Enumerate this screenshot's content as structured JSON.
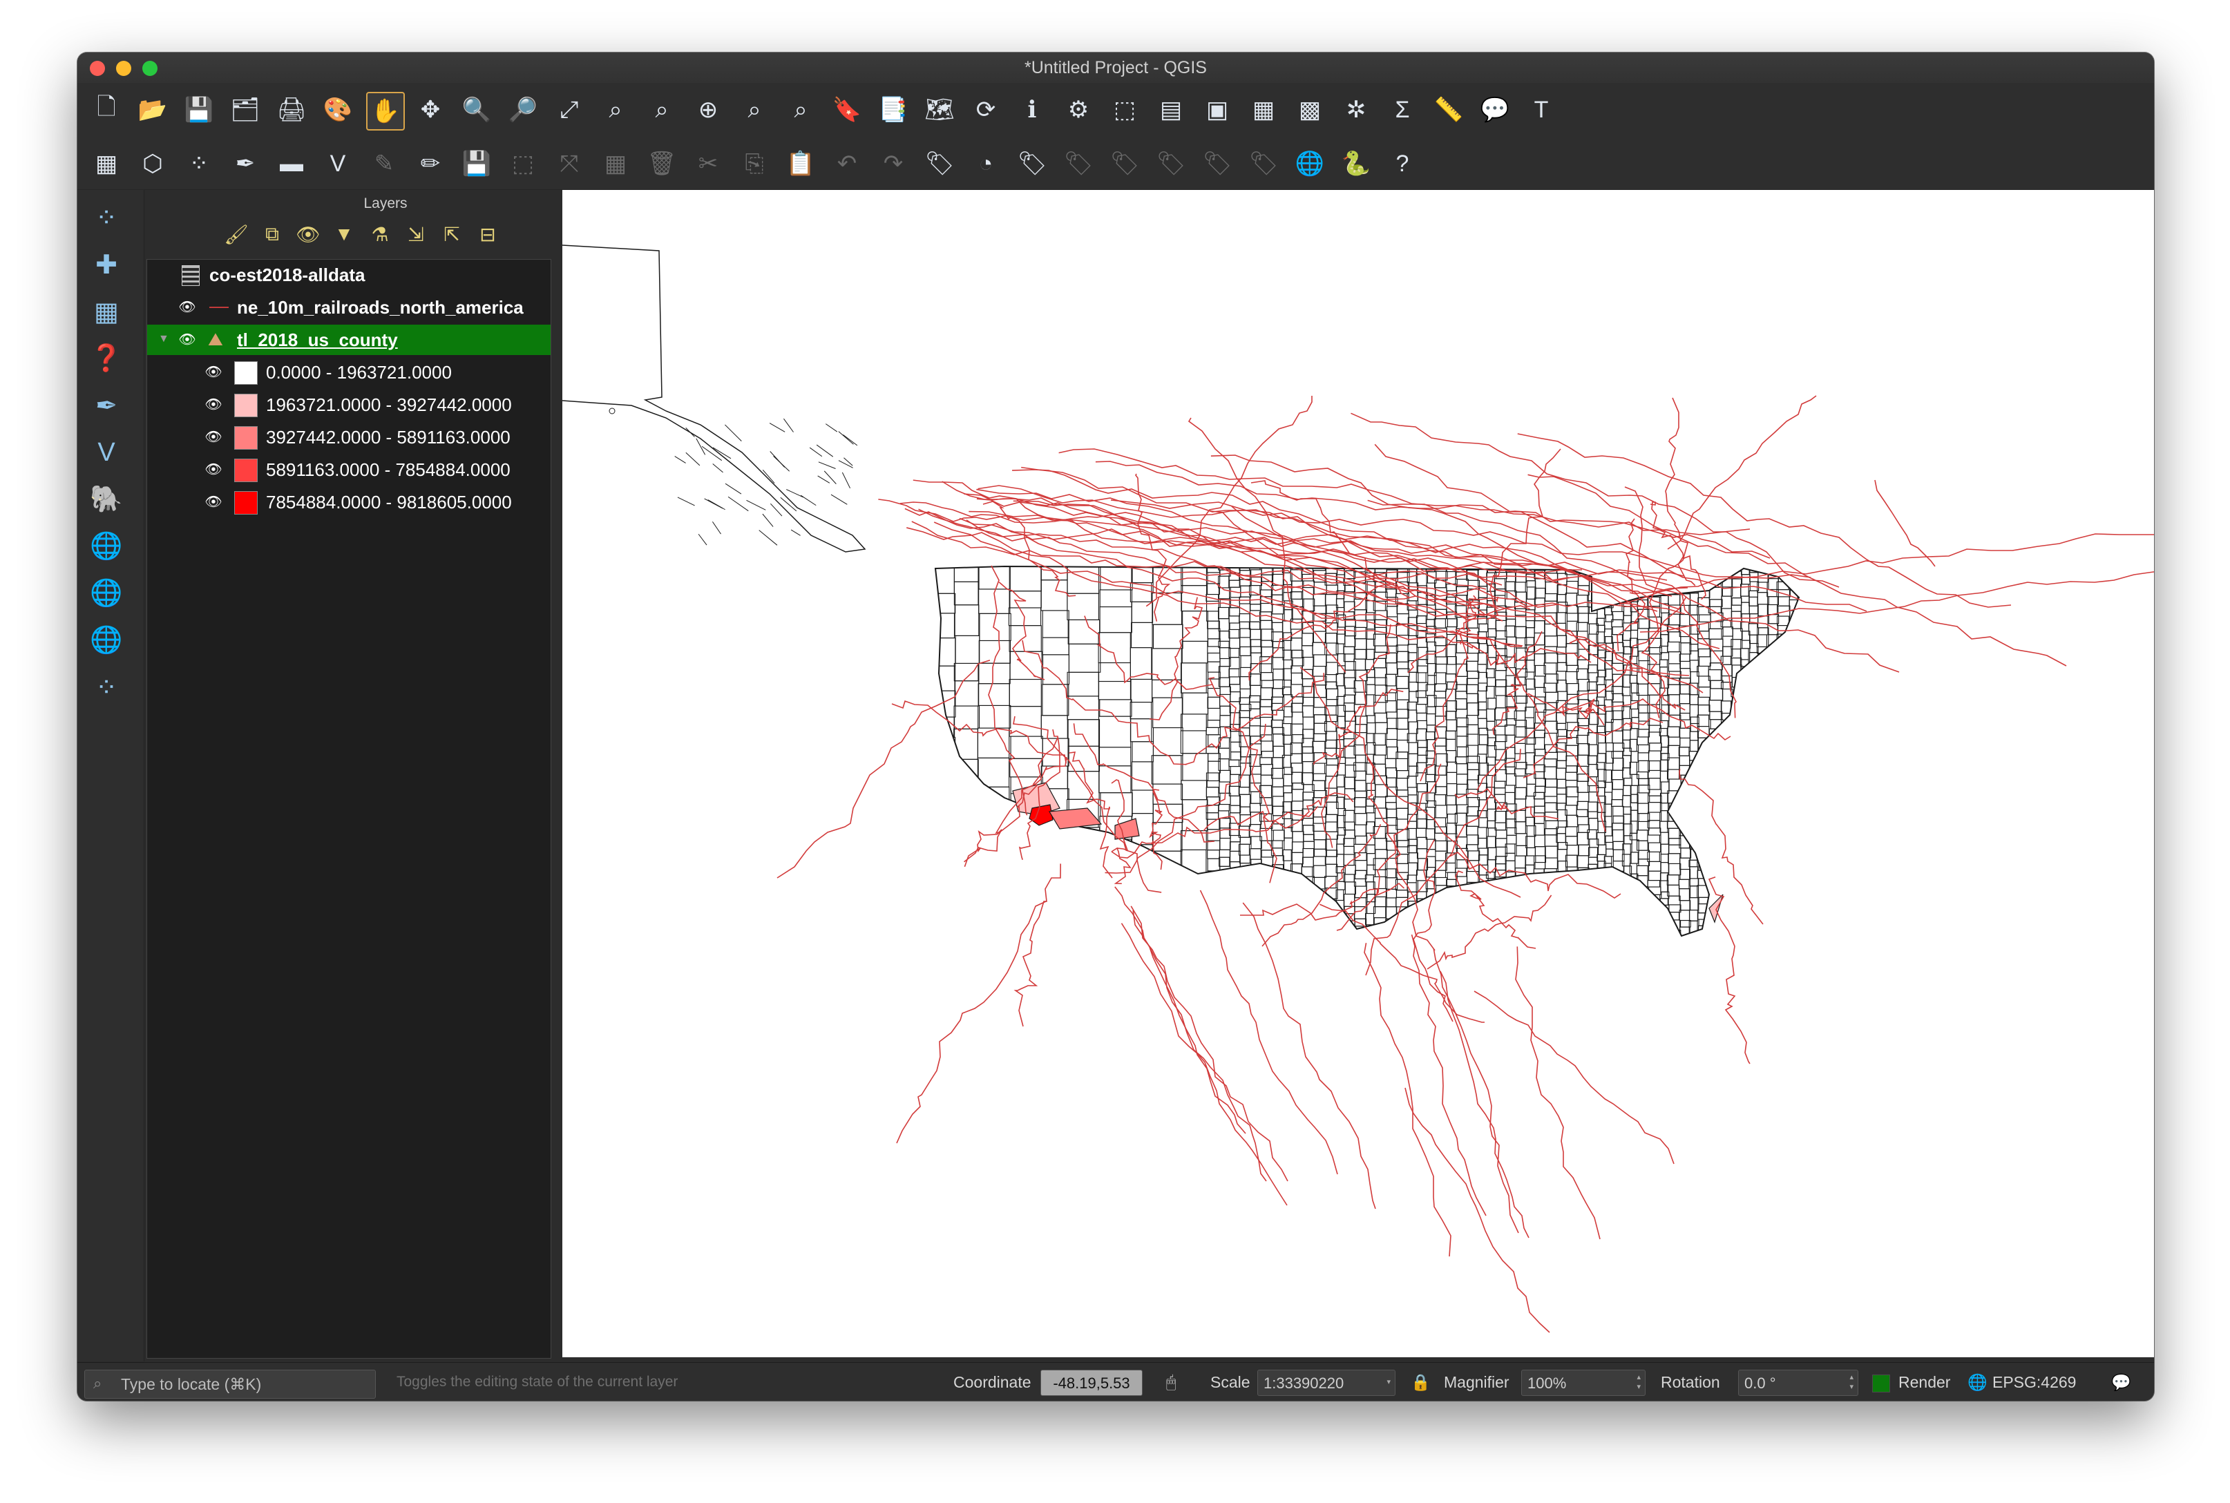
{
  "window": {
    "title": "*Untitled Project - QGIS"
  },
  "toolbar_row1": [
    {
      "name": "new-project-icon",
      "glyph": "🗋"
    },
    {
      "name": "open-project-icon",
      "glyph": "📂"
    },
    {
      "name": "save-project-icon",
      "glyph": "💾"
    },
    {
      "name": "save-as-icon",
      "glyph": "🗂"
    },
    {
      "name": "print-layout-icon",
      "glyph": "🖨"
    },
    {
      "name": "style-manager-icon",
      "glyph": "🎨"
    },
    {
      "name": "pan-icon",
      "glyph": "✋"
    },
    {
      "name": "pan-to-selection-icon",
      "glyph": "✥"
    },
    {
      "name": "zoom-in-icon",
      "glyph": "🔍"
    },
    {
      "name": "zoom-out-icon",
      "glyph": "🔎"
    },
    {
      "name": "zoom-full-icon",
      "glyph": "⤢"
    },
    {
      "name": "zoom-to-selection-icon",
      "glyph": "⌕"
    },
    {
      "name": "zoom-to-layer-icon",
      "glyph": "⌕"
    },
    {
      "name": "zoom-native-icon",
      "glyph": "⊕"
    },
    {
      "name": "zoom-last-icon",
      "glyph": "⌕"
    },
    {
      "name": "zoom-next-icon",
      "glyph": "⌕"
    },
    {
      "name": "new-bookmark-icon",
      "glyph": "🔖"
    },
    {
      "name": "show-bookmarks-icon",
      "glyph": "📑"
    },
    {
      "name": "new-map-view-icon",
      "glyph": "🗺"
    },
    {
      "name": "refresh-icon",
      "glyph": "⟳"
    },
    {
      "name": "identify-icon",
      "glyph": "ℹ"
    },
    {
      "name": "run-action-icon",
      "glyph": "⚙"
    },
    {
      "name": "select-features-icon",
      "glyph": "⬚"
    },
    {
      "name": "select-by-value-icon",
      "glyph": "▤"
    },
    {
      "name": "deselect-icon",
      "glyph": "▣"
    },
    {
      "name": "attribute-table-icon",
      "glyph": "▦"
    },
    {
      "name": "field-calculator-icon",
      "glyph": "▩"
    },
    {
      "name": "processing-toolbox-icon",
      "glyph": "✲"
    },
    {
      "name": "statistics-icon",
      "glyph": "Σ"
    },
    {
      "name": "measure-icon",
      "glyph": "📏"
    },
    {
      "name": "map-tips-icon",
      "glyph": "💬"
    },
    {
      "name": "text-annotation-icon",
      "glyph": "T"
    }
  ],
  "toolbar_row2": [
    {
      "name": "data-source-manager-icon",
      "glyph": "▦"
    },
    {
      "name": "new-geopackage-layer-icon",
      "glyph": "⬡"
    },
    {
      "name": "new-temporary-layer-icon",
      "glyph": "⁘"
    },
    {
      "name": "digitize-icon",
      "glyph": "✒"
    },
    {
      "name": "new-shapefile-layer-icon",
      "glyph": "▬"
    },
    {
      "name": "add-vector-icon",
      "glyph": "V"
    },
    {
      "name": "current-edits-icon",
      "glyph": "✎"
    },
    {
      "name": "toggle-editing-icon",
      "glyph": "✏"
    },
    {
      "name": "save-edits-icon",
      "glyph": "💾"
    },
    {
      "name": "add-feature-icon",
      "glyph": "⬚"
    },
    {
      "name": "vertex-tool-icon",
      "glyph": "⤧"
    },
    {
      "name": "modify-attributes-icon",
      "glyph": "▦"
    },
    {
      "name": "delete-selected-icon",
      "glyph": "🗑"
    },
    {
      "name": "cut-features-icon",
      "glyph": "✂"
    },
    {
      "name": "copy-features-icon",
      "glyph": "⎘"
    },
    {
      "name": "paste-features-icon",
      "glyph": "📋"
    },
    {
      "name": "undo-icon",
      "glyph": "↶"
    },
    {
      "name": "redo-icon",
      "glyph": "↷"
    },
    {
      "name": "label-tool-icon",
      "glyph": "🏷"
    },
    {
      "name": "diagram-tool-icon",
      "glyph": "◔"
    },
    {
      "name": "highlight-labels-icon",
      "glyph": "🏷"
    },
    {
      "name": "pin-labels-icon",
      "glyph": "🏷"
    },
    {
      "name": "show-hide-labels-icon",
      "glyph": "🏷"
    },
    {
      "name": "move-label-icon",
      "glyph": "🏷"
    },
    {
      "name": "rotate-label-icon",
      "glyph": "🏷"
    },
    {
      "name": "change-label-icon",
      "glyph": "🏷"
    },
    {
      "name": "georeferencer-icon",
      "glyph": "🌐"
    },
    {
      "name": "python-console-icon",
      "glyph": "🐍"
    },
    {
      "name": "help-icon",
      "glyph": "?"
    }
  ],
  "left_toolbar": [
    {
      "name": "add-delimited-text-icon",
      "glyph": "⁘"
    },
    {
      "name": "add-spatialite-icon",
      "glyph": "✚"
    },
    {
      "name": "add-raster-icon",
      "glyph": "▦"
    },
    {
      "name": "add-postgis-icon",
      "glyph": "❓"
    },
    {
      "name": "add-virtual-layer-icon",
      "glyph": "✒"
    },
    {
      "name": "add-vector-layer-icon",
      "glyph": "V"
    },
    {
      "name": "add-db-icon",
      "glyph": "🐘"
    },
    {
      "name": "add-wms-icon",
      "glyph": "🌐"
    },
    {
      "name": "add-wfs-icon",
      "glyph": "🌐"
    },
    {
      "name": "add-wcs-icon",
      "glyph": "🌐"
    },
    {
      "name": "add-mesh-icon",
      "glyph": "⁘"
    }
  ],
  "layers_panel": {
    "title": "Layers",
    "tools": [
      {
        "name": "open-styling-icon",
        "glyph": "🖌"
      },
      {
        "name": "add-group-icon",
        "glyph": "⧉"
      },
      {
        "name": "manage-themes-icon",
        "glyph": "👁"
      },
      {
        "name": "filter-legend-icon",
        "glyph": "▼"
      },
      {
        "name": "filter-by-expression-icon",
        "glyph": "⚗"
      },
      {
        "name": "expand-all-icon",
        "glyph": "⇲"
      },
      {
        "name": "collapse-all-icon",
        "glyph": "⇱"
      },
      {
        "name": "remove-layer-icon",
        "glyph": "⊟"
      }
    ],
    "layers": [
      {
        "label": "co-est2018-alldata"
      },
      {
        "label": "ne_10m_railroads_north_america"
      },
      {
        "label": "tl_2018_us_county"
      }
    ],
    "legend": [
      {
        "label": "0.0000 - 1963721.0000",
        "color": "#ffffff"
      },
      {
        "label": "1963721.0000 - 3927442.0000",
        "color": "#ffbfbf"
      },
      {
        "label": "3927442.0000 - 5891163.0000",
        "color": "#ff8080"
      },
      {
        "label": "5891163.0000 - 7854884.0000",
        "color": "#ff4040"
      },
      {
        "label": "7854884.0000 - 9818605.0000",
        "color": "#ff0000"
      }
    ]
  },
  "statusbar": {
    "locator_placeholder": "Type to locate (⌘K)",
    "hint": "Toggles the editing state of the current layer",
    "coordinate_label": "Coordinate",
    "coordinate_value": "-48.19,5.53",
    "scale_label": "Scale",
    "scale_value": "1:33390220",
    "magnifier_label": "Magnifier",
    "magnifier_value": "100%",
    "rotation_label": "Rotation",
    "rotation_value": "0.0 °",
    "render_label": "Render",
    "crs_label": "EPSG:4269"
  },
  "colors": {
    "railroad": "#d23b3b",
    "county_outline": "#1a1a1a",
    "selected_layer_bg": "#0b7a0b"
  }
}
